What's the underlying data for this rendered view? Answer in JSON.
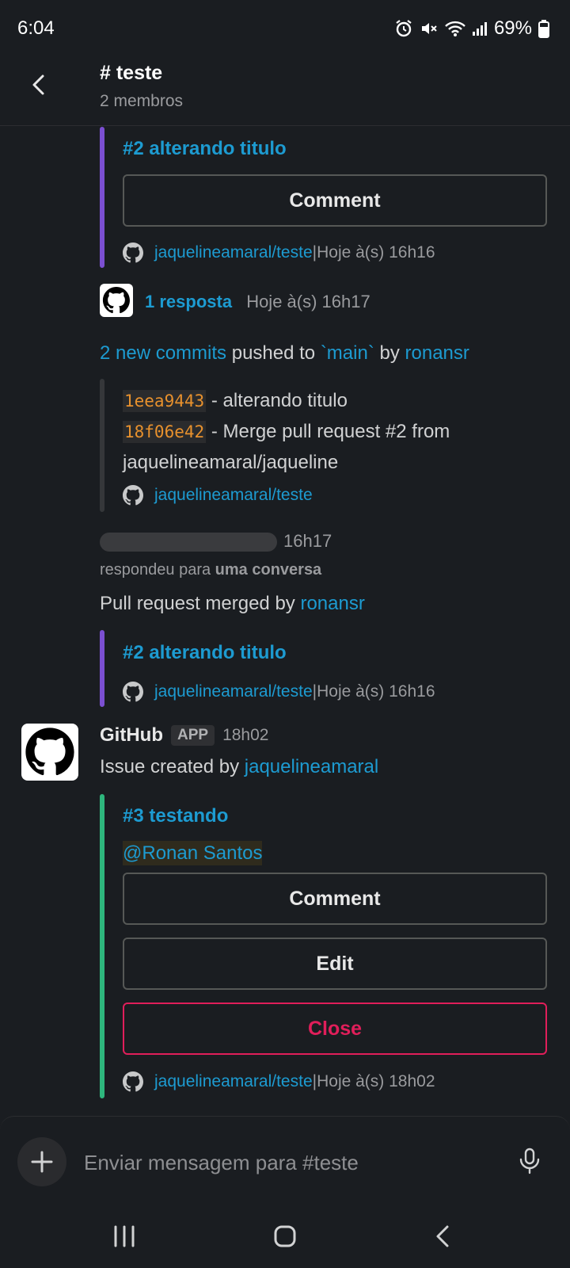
{
  "status": {
    "time": "6:04",
    "battery": "69%"
  },
  "header": {
    "title": "# teste",
    "subtitle": "2 membros"
  },
  "msg1": {
    "title": "#2 alterando titulo",
    "comment_label": "Comment",
    "repo": "jaquelineamaral/teste",
    "sep": " | ",
    "time": "Hoje à(s) 16h16"
  },
  "replies": {
    "count": "1 resposta",
    "time": "Hoje à(s) 16h17"
  },
  "commits": {
    "link": "2 new commits",
    "text1": " pushed to ",
    "branch": "`main`",
    "text2": " by ",
    "user": "ronansr",
    "c1_hash": "1eea9443",
    "c1_msg": " - alterando titulo",
    "c2_hash": "18f06e42",
    "c2_msg": " - Merge pull request #2 from",
    "c2_msg_line2": "jaquelineamaral/jaqueline",
    "repo": "jaquelineamaral/teste"
  },
  "reply_meta": {
    "time": "16h17",
    "prefix": "respondeu para ",
    "target": "uma conversa"
  },
  "merged": {
    "text": "Pull request merged by ",
    "user": "ronansr",
    "title": "#2 alterando titulo",
    "repo": "jaquelineamaral/teste",
    "sep": " | ",
    "time": "Hoje à(s) 16h16"
  },
  "github_msg": {
    "sender": "GitHub",
    "badge": "APP",
    "time": "18h02",
    "text": "Issue created by ",
    "user": "jaquelineamaral",
    "title": "#3 testando",
    "mention": "@Ronan Santos",
    "btn_comment": "Comment",
    "btn_edit": "Edit",
    "btn_close": "Close",
    "repo": "jaquelineamaral/teste",
    "sep": " | ",
    "footer_time": "Hoje à(s) 18h02"
  },
  "composer": {
    "placeholder": "Enviar mensagem para #teste"
  },
  "colors": {
    "bg": "#1a1d21",
    "link": "#1d9bd1",
    "purple": "#7b4fd1",
    "green": "#2eb67d",
    "close": "#e01e5a"
  },
  "icons": [
    "back-arrow-icon",
    "alarm-icon",
    "mute-icon",
    "wifi-icon",
    "signal-icon",
    "battery-icon",
    "github-icon",
    "plus-icon",
    "mic-icon",
    "recents-icon",
    "home-icon",
    "back-icon"
  ]
}
